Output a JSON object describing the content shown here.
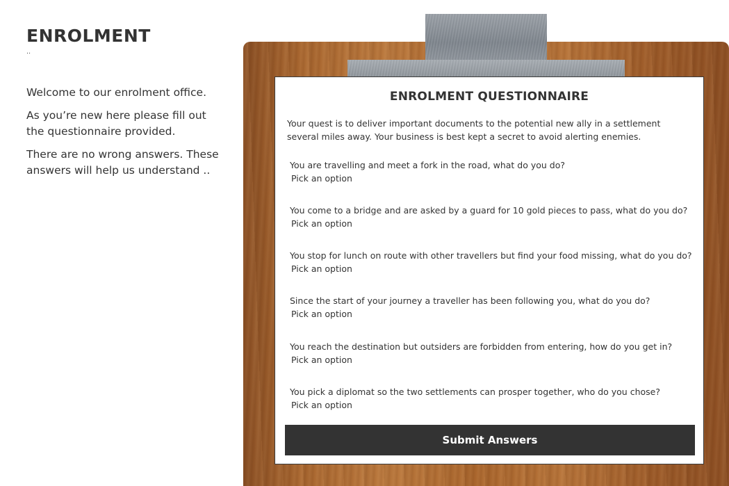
{
  "left": {
    "title": "ENROLMENT",
    "subtitle": "..",
    "paragraphs": [
      "Welcome to our enrolment office.",
      "As you’re new here please fill out the questionnaire provided.",
      "There are no wrong answers. These answers will help us understand .."
    ]
  },
  "questionnaire": {
    "title": "ENROLMENT QUESTIONNAIRE",
    "description": "Your quest is to deliver important documents to the potential new ally in a settlement several miles away. Your business is best kept a secret to avoid alerting enemies.",
    "questions": [
      {
        "text": "You are travelling and meet a fork in the road, what do you do?",
        "selected": "Pick an option"
      },
      {
        "text": "You come to a bridge and are asked by a guard for 10 gold pieces to pass, what do you do?",
        "selected": "Pick an option"
      },
      {
        "text": "You stop for lunch on route with other travellers but find your food missing, what do you do?",
        "selected": "Pick an option"
      },
      {
        "text": "Since the start of your journey a traveller has been following you, what do you do?",
        "selected": "Pick an option"
      },
      {
        "text": "You reach the destination but outsiders are forbidden from entering, how do you get in?",
        "selected": "Pick an option"
      },
      {
        "text": "You pick a diplomat so the two settlements can prosper together, who do you chose?",
        "selected": "Pick an option"
      }
    ],
    "submit_label": "Submit Answers"
  }
}
